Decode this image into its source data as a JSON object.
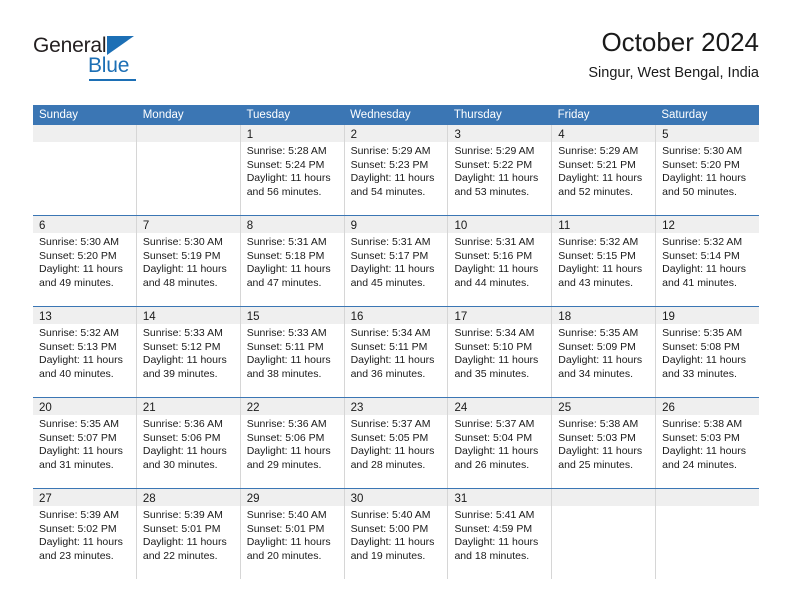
{
  "brand": {
    "name_top": "General",
    "name_bottom": "Blue",
    "accent_color": "#1c6fb5",
    "triangle_icon": "triangle-icon"
  },
  "header": {
    "title": "October 2024",
    "subtitle": "Singur, West Bengal, India"
  },
  "theme": {
    "header_band": "#3b76b4",
    "daynum_band": "#efefef",
    "cell_border": "#d6d6d6",
    "text": "#1a1a1a"
  },
  "calendar": {
    "weekdays": [
      "Sunday",
      "Monday",
      "Tuesday",
      "Wednesday",
      "Thursday",
      "Friday",
      "Saturday"
    ],
    "weeks": [
      [
        {
          "day": ""
        },
        {
          "day": ""
        },
        {
          "day": "1",
          "sunrise": "Sunrise: 5:28 AM",
          "sunset": "Sunset: 5:24 PM",
          "daylight1": "Daylight: 11 hours",
          "daylight2": "and 56 minutes."
        },
        {
          "day": "2",
          "sunrise": "Sunrise: 5:29 AM",
          "sunset": "Sunset: 5:23 PM",
          "daylight1": "Daylight: 11 hours",
          "daylight2": "and 54 minutes."
        },
        {
          "day": "3",
          "sunrise": "Sunrise: 5:29 AM",
          "sunset": "Sunset: 5:22 PM",
          "daylight1": "Daylight: 11 hours",
          "daylight2": "and 53 minutes."
        },
        {
          "day": "4",
          "sunrise": "Sunrise: 5:29 AM",
          "sunset": "Sunset: 5:21 PM",
          "daylight1": "Daylight: 11 hours",
          "daylight2": "and 52 minutes."
        },
        {
          "day": "5",
          "sunrise": "Sunrise: 5:30 AM",
          "sunset": "Sunset: 5:20 PM",
          "daylight1": "Daylight: 11 hours",
          "daylight2": "and 50 minutes."
        }
      ],
      [
        {
          "day": "6",
          "sunrise": "Sunrise: 5:30 AM",
          "sunset": "Sunset: 5:20 PM",
          "daylight1": "Daylight: 11 hours",
          "daylight2": "and 49 minutes."
        },
        {
          "day": "7",
          "sunrise": "Sunrise: 5:30 AM",
          "sunset": "Sunset: 5:19 PM",
          "daylight1": "Daylight: 11 hours",
          "daylight2": "and 48 minutes."
        },
        {
          "day": "8",
          "sunrise": "Sunrise: 5:31 AM",
          "sunset": "Sunset: 5:18 PM",
          "daylight1": "Daylight: 11 hours",
          "daylight2": "and 47 minutes."
        },
        {
          "day": "9",
          "sunrise": "Sunrise: 5:31 AM",
          "sunset": "Sunset: 5:17 PM",
          "daylight1": "Daylight: 11 hours",
          "daylight2": "and 45 minutes."
        },
        {
          "day": "10",
          "sunrise": "Sunrise: 5:31 AM",
          "sunset": "Sunset: 5:16 PM",
          "daylight1": "Daylight: 11 hours",
          "daylight2": "and 44 minutes."
        },
        {
          "day": "11",
          "sunrise": "Sunrise: 5:32 AM",
          "sunset": "Sunset: 5:15 PM",
          "daylight1": "Daylight: 11 hours",
          "daylight2": "and 43 minutes."
        },
        {
          "day": "12",
          "sunrise": "Sunrise: 5:32 AM",
          "sunset": "Sunset: 5:14 PM",
          "daylight1": "Daylight: 11 hours",
          "daylight2": "and 41 minutes."
        }
      ],
      [
        {
          "day": "13",
          "sunrise": "Sunrise: 5:32 AM",
          "sunset": "Sunset: 5:13 PM",
          "daylight1": "Daylight: 11 hours",
          "daylight2": "and 40 minutes."
        },
        {
          "day": "14",
          "sunrise": "Sunrise: 5:33 AM",
          "sunset": "Sunset: 5:12 PM",
          "daylight1": "Daylight: 11 hours",
          "daylight2": "and 39 minutes."
        },
        {
          "day": "15",
          "sunrise": "Sunrise: 5:33 AM",
          "sunset": "Sunset: 5:11 PM",
          "daylight1": "Daylight: 11 hours",
          "daylight2": "and 38 minutes."
        },
        {
          "day": "16",
          "sunrise": "Sunrise: 5:34 AM",
          "sunset": "Sunset: 5:11 PM",
          "daylight1": "Daylight: 11 hours",
          "daylight2": "and 36 minutes."
        },
        {
          "day": "17",
          "sunrise": "Sunrise: 5:34 AM",
          "sunset": "Sunset: 5:10 PM",
          "daylight1": "Daylight: 11 hours",
          "daylight2": "and 35 minutes."
        },
        {
          "day": "18",
          "sunrise": "Sunrise: 5:35 AM",
          "sunset": "Sunset: 5:09 PM",
          "daylight1": "Daylight: 11 hours",
          "daylight2": "and 34 minutes."
        },
        {
          "day": "19",
          "sunrise": "Sunrise: 5:35 AM",
          "sunset": "Sunset: 5:08 PM",
          "daylight1": "Daylight: 11 hours",
          "daylight2": "and 33 minutes."
        }
      ],
      [
        {
          "day": "20",
          "sunrise": "Sunrise: 5:35 AM",
          "sunset": "Sunset: 5:07 PM",
          "daylight1": "Daylight: 11 hours",
          "daylight2": "and 31 minutes."
        },
        {
          "day": "21",
          "sunrise": "Sunrise: 5:36 AM",
          "sunset": "Sunset: 5:06 PM",
          "daylight1": "Daylight: 11 hours",
          "daylight2": "and 30 minutes."
        },
        {
          "day": "22",
          "sunrise": "Sunrise: 5:36 AM",
          "sunset": "Sunset: 5:06 PM",
          "daylight1": "Daylight: 11 hours",
          "daylight2": "and 29 minutes."
        },
        {
          "day": "23",
          "sunrise": "Sunrise: 5:37 AM",
          "sunset": "Sunset: 5:05 PM",
          "daylight1": "Daylight: 11 hours",
          "daylight2": "and 28 minutes."
        },
        {
          "day": "24",
          "sunrise": "Sunrise: 5:37 AM",
          "sunset": "Sunset: 5:04 PM",
          "daylight1": "Daylight: 11 hours",
          "daylight2": "and 26 minutes."
        },
        {
          "day": "25",
          "sunrise": "Sunrise: 5:38 AM",
          "sunset": "Sunset: 5:03 PM",
          "daylight1": "Daylight: 11 hours",
          "daylight2": "and 25 minutes."
        },
        {
          "day": "26",
          "sunrise": "Sunrise: 5:38 AM",
          "sunset": "Sunset: 5:03 PM",
          "daylight1": "Daylight: 11 hours",
          "daylight2": "and 24 minutes."
        }
      ],
      [
        {
          "day": "27",
          "sunrise": "Sunrise: 5:39 AM",
          "sunset": "Sunset: 5:02 PM",
          "daylight1": "Daylight: 11 hours",
          "daylight2": "and 23 minutes."
        },
        {
          "day": "28",
          "sunrise": "Sunrise: 5:39 AM",
          "sunset": "Sunset: 5:01 PM",
          "daylight1": "Daylight: 11 hours",
          "daylight2": "and 22 minutes."
        },
        {
          "day": "29",
          "sunrise": "Sunrise: 5:40 AM",
          "sunset": "Sunset: 5:01 PM",
          "daylight1": "Daylight: 11 hours",
          "daylight2": "and 20 minutes."
        },
        {
          "day": "30",
          "sunrise": "Sunrise: 5:40 AM",
          "sunset": "Sunset: 5:00 PM",
          "daylight1": "Daylight: 11 hours",
          "daylight2": "and 19 minutes."
        },
        {
          "day": "31",
          "sunrise": "Sunrise: 5:41 AM",
          "sunset": "Sunset: 4:59 PM",
          "daylight1": "Daylight: 11 hours",
          "daylight2": "and 18 minutes."
        },
        {
          "day": ""
        },
        {
          "day": ""
        }
      ]
    ]
  }
}
